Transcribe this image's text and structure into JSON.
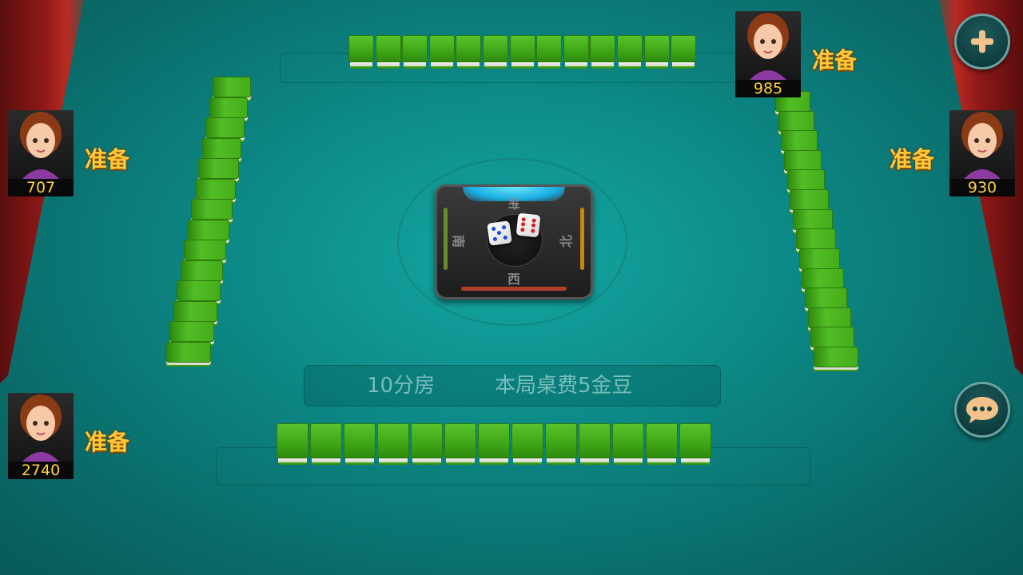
{
  "players": {
    "top": {
      "score": "985",
      "status": "准备"
    },
    "left": {
      "score": "707",
      "status": "准备"
    },
    "right": {
      "score": "930",
      "status": "准备"
    },
    "bottom": {
      "score": "2740",
      "status": "准备"
    }
  },
  "compass": {
    "east": "东",
    "south": "南",
    "west": "西",
    "north": "北"
  },
  "room": {
    "name": "10分房",
    "fee": "本局桌费5金豆"
  },
  "buttons": {
    "add_icon": "plus-icon",
    "chat_icon": "chat-bubble-icon"
  },
  "colors": {
    "felt": "#0d8c89",
    "tile_green": "#45ac19",
    "ready_text": "#ffc93a",
    "score_text": "#ffd23a"
  }
}
